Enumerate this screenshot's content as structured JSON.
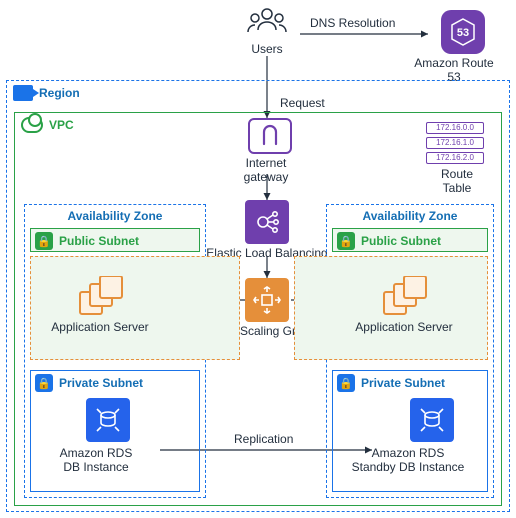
{
  "top": {
    "users": "Users",
    "dns": "DNS Resolution",
    "route53": "Amazon Route 53",
    "request": "Request"
  },
  "region": {
    "label": "Region"
  },
  "vpc": {
    "label": "VPC"
  },
  "igw": {
    "title": "Internet",
    "sub": "gateway"
  },
  "elb": "Elastic Load Balancing",
  "asg": "Auto Scaling Groups",
  "route_table": {
    "label": "Route Table",
    "rows": [
      "172.16.0.0",
      "172.16.1.0",
      "172.16.2.0"
    ]
  },
  "az": {
    "left": "Availability Zone",
    "right": "Availability Zone"
  },
  "subnet": {
    "public_left": "Public Subnet",
    "public_right": "Public Subnet",
    "private_left": "Private Subnet",
    "private_right": "Private Subnet"
  },
  "app": {
    "left": "Application Server",
    "right": "Application Server"
  },
  "rds": {
    "left_l1": "Amazon RDS",
    "left_l2": "DB Instance",
    "right_l1": "Amazon RDS",
    "right_l2": "Standby DB Instance",
    "replication": "Replication"
  }
}
